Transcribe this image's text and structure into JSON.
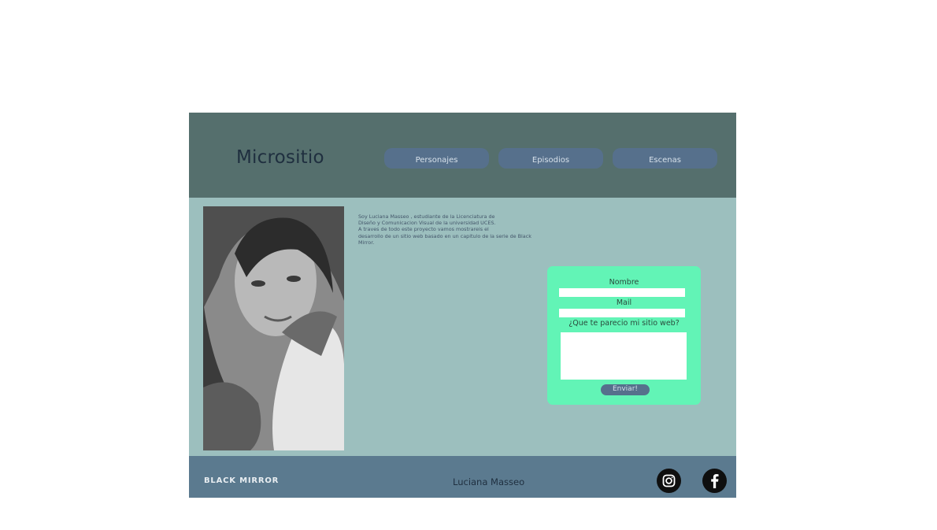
{
  "header": {
    "title": "Micrositio",
    "nav": [
      {
        "label": "Personajes"
      },
      {
        "label": "Episodios"
      },
      {
        "label": "Escenas"
      }
    ]
  },
  "bio": {
    "lines": [
      "Soy Luciana Masseo , estudiante de la Licenciatura de",
      "Diseño y Comunicacion Visual de la universidad UCES.",
      "A traves de todo este proyecto vamos mostrareis el",
      "desarrollo de un sitio web basado en un capitulo de la serie de Black",
      "Mirror."
    ]
  },
  "form": {
    "name_label": "Nombre",
    "mail_label": "Mail",
    "question_label": "¿Que te parecio mi sitio web?",
    "name_value": "",
    "mail_value": "",
    "comment_value": "",
    "submit_label": "Enviar!"
  },
  "footer": {
    "brand": "BLACK MIRROR",
    "author": "Luciana Masseo",
    "social": [
      {
        "icon": "instagram-icon"
      },
      {
        "icon": "facebook-icon"
      }
    ]
  },
  "colors": {
    "header_bg": "#556f6d",
    "content_bg": "#9cbfbe",
    "footer_bg": "#5b7a8f",
    "button_bg": "#56708c",
    "form_bg": "#62f4b6"
  }
}
